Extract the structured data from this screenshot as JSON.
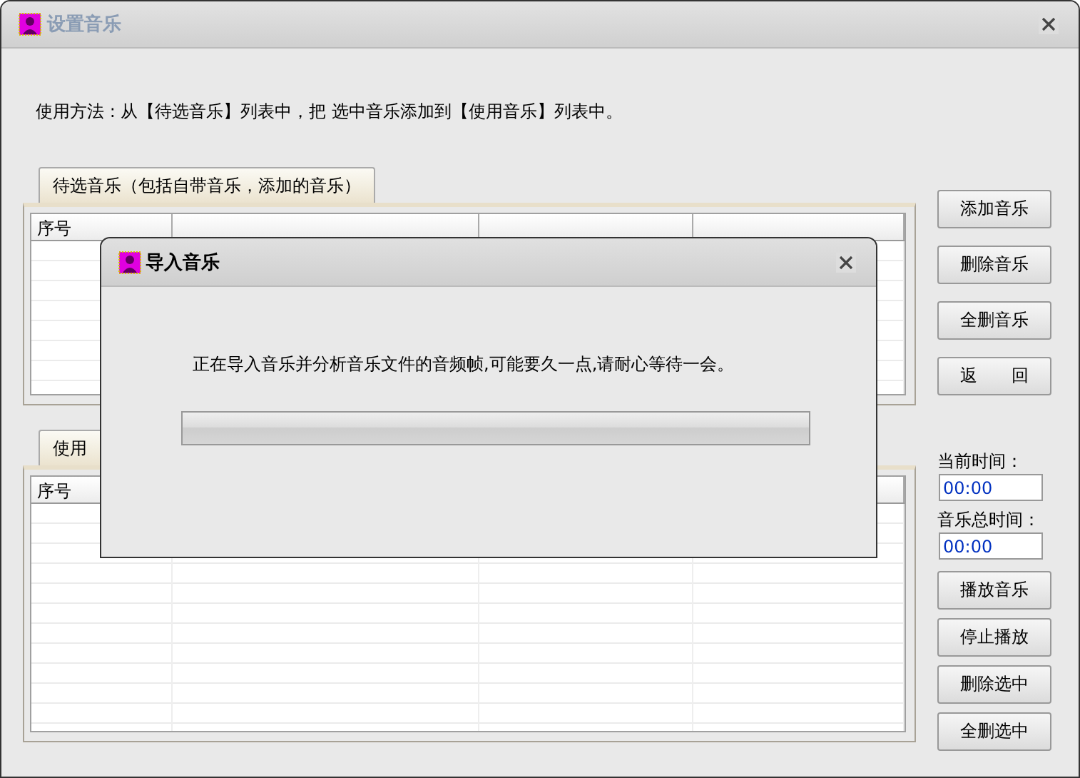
{
  "window": {
    "title": "设置音乐",
    "active": false
  },
  "instructions": "使用方法 : 从【待选音乐】列表中，把 选中音乐添加到【使用音乐】列表中。",
  "candidate_list": {
    "tab": "待选音乐（包括自带音乐，添加的音乐）",
    "columns": [
      "序号"
    ]
  },
  "candidate_buttons": [
    "添加音乐",
    "删除音乐",
    "全删音乐",
    "返　　回"
  ],
  "used_list": {
    "tab": "使用",
    "columns": [
      "序号"
    ]
  },
  "time_fields": [
    {
      "label": "当前时间：",
      "value": "00:00"
    },
    {
      "label": "音乐总时间：",
      "value": "00:00"
    }
  ],
  "used_buttons": [
    "播放音乐",
    "停止播放",
    "删除选中",
    "全删选中"
  ],
  "dialog": {
    "title": "导入音乐",
    "message": "正在导入音乐并分析音乐文件的音频帧,可能要久一点,请耐心等待一会。",
    "progress": {
      "level": 0
    }
  }
}
